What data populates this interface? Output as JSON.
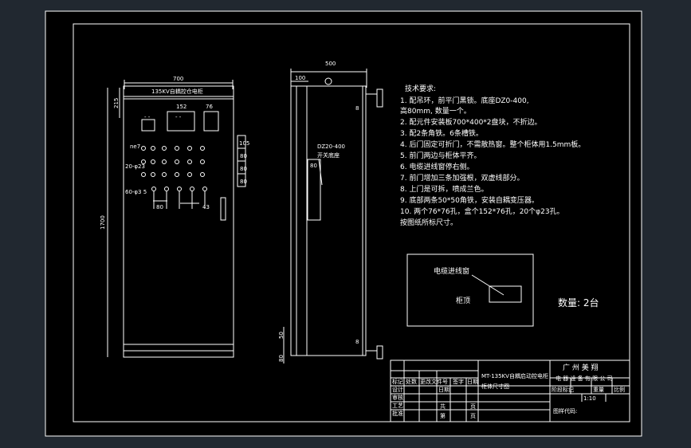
{
  "front_view": {
    "top_width": "700",
    "top_dim_215": "215",
    "height_dim": "1700",
    "nameplate": "135KV自耦控仓电柜",
    "w152": "152",
    "w76": "76",
    "label_ne7": "ne7",
    "label_20_23": "20-φ23",
    "label_60_3": "60-φ3 5",
    "dim_80": "80",
    "dim_43": "43",
    "side_dims": [
      "105",
      "80",
      "80",
      "80"
    ],
    "dash": "- -"
  },
  "side_view": {
    "width": "500",
    "w100": "100",
    "dim_8_top": "8",
    "dim_8_bottom": "8",
    "dim_50": "50",
    "dim_80_side": "80",
    "dz_label": "DZ20-400",
    "dz_sub": "开关底座",
    "dz_80": "80"
  },
  "tech": {
    "heading": "技术要求:",
    "items": [
      "1. 配吊环，前平门黑锁。底座DZ0-400,",
      "   高80mm, 数量一个。",
      "2. 配元件安装板700*400*2盘块，不折边。",
      "3. 配2条角铁。6条槽铁。",
      "4. 后门固定可折门，不需散热窗。整个柜体用1.5mm板。",
      "5. 前门两边与柜体平齐。",
      "6. 电缆进线窗停右侧。",
      "7. 前门增加三条加强根，双虚线部分。",
      "8. 上门是可拆，喷成兰色。",
      "9. 底部两条50*50角铁，安装自耦变压器。",
      "10. 两个76*76孔，盒个152*76孔，20个φ23孔。",
      "   按图纸所标尺寸。"
    ]
  },
  "detail": {
    "window_label": "电缆进线窗",
    "cabinet_label": "柜顶"
  },
  "quantity": "数量: 2台",
  "title_block": {
    "company_line1": "广 州 美 翔",
    "company_line2": "电 器 设 备 有 限 公 司",
    "drawing_name_line1": "MT-135KV自耦启动控电柜",
    "drawing_name_line2": "柜体尺寸图",
    "rows": [
      "标记",
      "处数",
      "更改文件号",
      "签字",
      "日期"
    ],
    "left_labels": [
      "设计",
      "审核",
      "工艺",
      "批准",
      "日期"
    ],
    "stage_header": [
      "阶段标记",
      "重量",
      "比例"
    ],
    "scale": "1:10",
    "sheet_total": "共",
    "sheet_page": "第",
    "sheet_unit1": "页",
    "sheet_unit2": "页",
    "drawing_no_label": "图样代码:"
  },
  "colors": {
    "background": "#212830",
    "line": "#ffffff",
    "frame": "#000000"
  }
}
